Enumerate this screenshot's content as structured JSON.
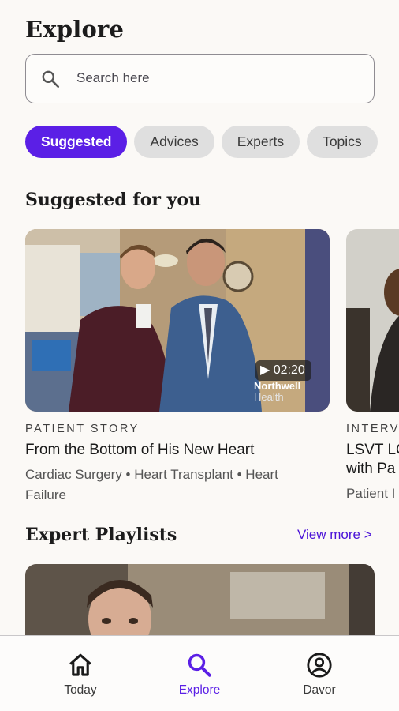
{
  "header": {
    "title": "Explore"
  },
  "search": {
    "placeholder": "Search here",
    "icon": "search-icon"
  },
  "chips": [
    {
      "label": "Suggested",
      "active": true
    },
    {
      "label": "Advices",
      "active": false
    },
    {
      "label": "Experts",
      "active": false
    },
    {
      "label": "Topics",
      "active": false
    }
  ],
  "suggested": {
    "title": "Suggested for you",
    "cards": [
      {
        "category": "PATIENT STORY",
        "title": "From the Bottom of His New Heart",
        "tags": "Cardiac Surgery  • Heart Transplant • Heart Failure",
        "duration": "02:20",
        "brand": "Northwell",
        "brand_sub": "Health"
      },
      {
        "category": "INTERV",
        "title": "LSVT LO",
        "title2": "with Pa",
        "tags": "Patient I"
      }
    ]
  },
  "playlists": {
    "title": "Expert Playlists",
    "view_more": "View more >"
  },
  "bottom_nav": [
    {
      "label": "Today",
      "icon": "home-icon",
      "active": false
    },
    {
      "label": "Explore",
      "icon": "search-icon",
      "active": true
    },
    {
      "label": "Davor",
      "icon": "account-circle-icon",
      "active": false
    }
  ],
  "colors": {
    "accent": "#5b1fe6",
    "background": "#fbf9f6",
    "chip_inactive": "#dfdfdf"
  }
}
